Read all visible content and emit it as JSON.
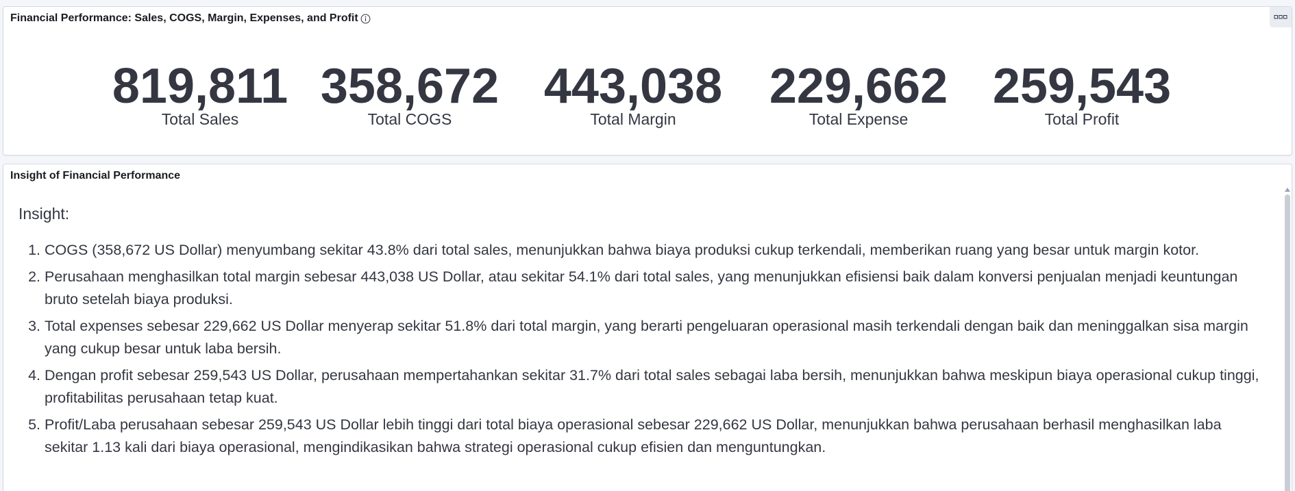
{
  "metrics_panel": {
    "title": "Financial Performance: Sales, COGS, Margin, Expenses, and Profit",
    "info_icon": "info-circle-icon",
    "options_icon": "ellipsis-icon",
    "metrics": [
      {
        "value": "819,811",
        "label": "Total Sales"
      },
      {
        "value": "358,672",
        "label": "Total COGS"
      },
      {
        "value": "443,038",
        "label": "Total Margin"
      },
      {
        "value": "229,662",
        "label": "Total Expense"
      },
      {
        "value": "259,543",
        "label": "Total Profit"
      }
    ]
  },
  "insight_panel": {
    "title": "Insight of Financial Performance",
    "heading": "Insight:",
    "items": [
      "COGS (358,672 US Dollar) menyumbang sekitar 43.8% dari total sales, menunjukkan bahwa biaya produksi cukup terkendali, memberikan ruang yang besar untuk margin kotor.",
      "Perusahaan menghasilkan total margin sebesar 443,038 US Dollar, atau sekitar 54.1% dari total sales, yang menunjukkan efisiensi baik dalam konversi penjualan menjadi keuntungan bruto setelah biaya produksi.",
      "Total expenses sebesar 229,662 US Dollar menyerap sekitar 51.8% dari total margin, yang berarti pengeluaran operasional masih terkendali dengan baik dan meninggalkan sisa margin yang cukup besar untuk laba bersih.",
      "Dengan profit sebesar 259,543 US Dollar, perusahaan mempertahankan sekitar 31.7% dari total sales sebagai laba bersih, menunjukkan bahwa meskipun biaya operasional cukup tinggi, profitabilitas perusahaan tetap kuat.",
      "Profit/Laba perusahaan sebesar 259,543 US Dollar lebih tinggi dari total biaya operasional sebesar 229,662 US Dollar, menunjukkan bahwa perusahaan berhasil menghasilkan laba sekitar 1.13 kali dari biaya operasional, mengindikasikan bahwa strategi operasional cukup efisien dan menguntungkan."
    ]
  },
  "colors": {
    "text": "#343741",
    "title": "#1a1c21",
    "border": "#d3dae6",
    "background": "#f4f6fa"
  }
}
